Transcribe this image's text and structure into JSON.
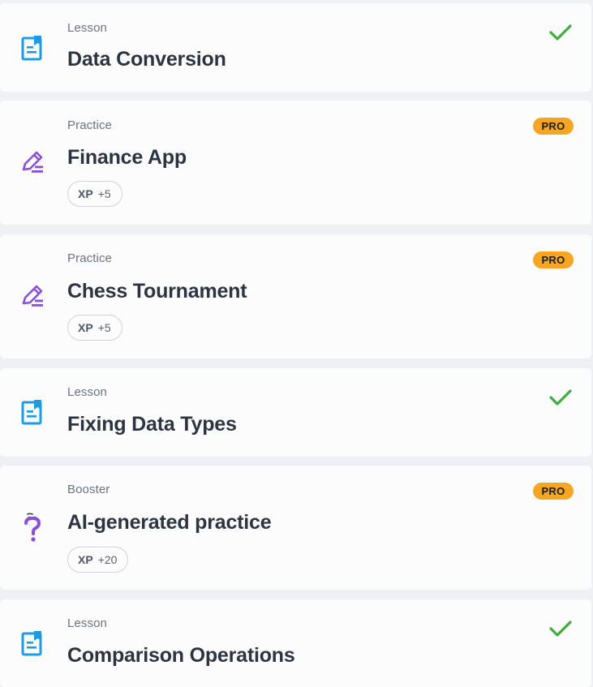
{
  "colors": {
    "lesson_icon": "#1e9be6",
    "practice_icon": "#8a4fd8",
    "booster_icon": "#8a4fd8",
    "check": "#3fae3f",
    "pro_badge": "#f6a623"
  },
  "items": [
    {
      "type": "Lesson",
      "title": "Data Conversion",
      "icon": "lesson-icon",
      "completed": true
    },
    {
      "type": "Practice",
      "title": "Finance App",
      "icon": "practice-pencil-icon",
      "badge": "PRO",
      "xp_label": "XP",
      "xp_value": "+5"
    },
    {
      "type": "Practice",
      "title": "Chess Tournament",
      "icon": "practice-pencil-icon",
      "badge": "PRO",
      "xp_label": "XP",
      "xp_value": "+5"
    },
    {
      "type": "Lesson",
      "title": "Fixing Data Types",
      "icon": "lesson-icon",
      "completed": true
    },
    {
      "type": "Booster",
      "title": "AI-generated practice",
      "icon": "booster-question-icon",
      "badge": "PRO",
      "xp_label": "XP",
      "xp_value": "+20"
    },
    {
      "type": "Lesson",
      "title": "Comparison Operations",
      "icon": "lesson-icon",
      "completed": true
    }
  ]
}
